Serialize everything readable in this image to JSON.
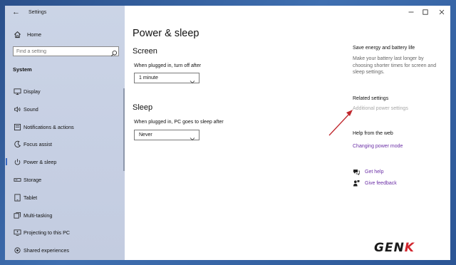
{
  "window": {
    "title": "Settings",
    "back_glyph": "←"
  },
  "sidebar": {
    "home_label": "Home",
    "search_placeholder": "Find a setting",
    "section": "System",
    "items": [
      {
        "label": "Display",
        "icon": "display-icon"
      },
      {
        "label": "Sound",
        "icon": "sound-icon"
      },
      {
        "label": "Notifications & actions",
        "icon": "notifications-icon"
      },
      {
        "label": "Focus assist",
        "icon": "focus-assist-icon"
      },
      {
        "label": "Power & sleep",
        "icon": "power-icon",
        "selected": true
      },
      {
        "label": "Storage",
        "icon": "storage-icon"
      },
      {
        "label": "Tablet",
        "icon": "tablet-icon"
      },
      {
        "label": "Multi-tasking",
        "icon": "multitasking-icon"
      },
      {
        "label": "Projecting to this PC",
        "icon": "projecting-icon"
      },
      {
        "label": "Shared experiences",
        "icon": "shared-experiences-icon"
      }
    ]
  },
  "main": {
    "title": "Power & sleep",
    "screen": {
      "heading": "Screen",
      "label": "When plugged in, turn off after",
      "value": "1 minute"
    },
    "sleep": {
      "heading": "Sleep",
      "label": "When plugged in, PC goes to sleep after",
      "value": "Never"
    }
  },
  "right": {
    "save_heading": "Save energy and battery life",
    "save_desc": "Make your battery last longer by choosing shorter times for screen and sleep settings.",
    "related_heading": "Related settings",
    "additional_power": "Additional power settings",
    "help_heading": "Help from the web",
    "changing_power": "Changing power mode",
    "get_help": "Get help",
    "give_feedback": "Give feedback"
  },
  "watermark": {
    "part1": "GEN",
    "part2": "K"
  },
  "colors": {
    "accent": "#3a6bc4",
    "link": "#6b2fa6",
    "annotation_arrow": "#c0272d"
  }
}
